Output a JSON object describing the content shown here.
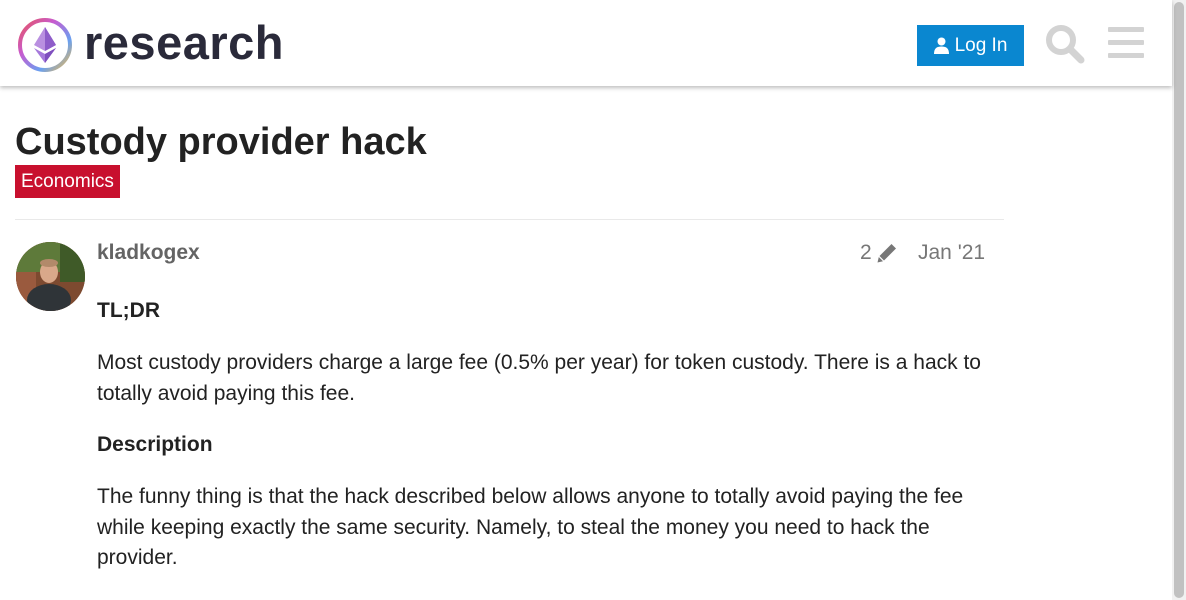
{
  "header": {
    "site_name": "research",
    "login_label": "Log In",
    "colors": {
      "login_bg": "#0a87d0",
      "icon_gray": "#d3d3d3"
    },
    "icons": {
      "login": "user-icon",
      "search": "search-icon",
      "menu": "hamburger-icon"
    }
  },
  "topic": {
    "title": "Custody provider hack",
    "category": "Economics",
    "category_color": "#c8102e"
  },
  "post": {
    "username": "kladkogex",
    "edit_count": "2",
    "edit_icon": "pencil-icon",
    "date": "Jan '21",
    "heading1": "TL;DR",
    "para1": "Most custody providers charge a large fee (0.5% per year) for token custody. There is a hack to totally avoid paying this fee.",
    "heading2": "Description",
    "para2": "The funny thing is that the hack described below allows anyone to totally avoid paying the fee while keeping exactly the same security. Namely, to steal the money you need to hack the provider."
  }
}
